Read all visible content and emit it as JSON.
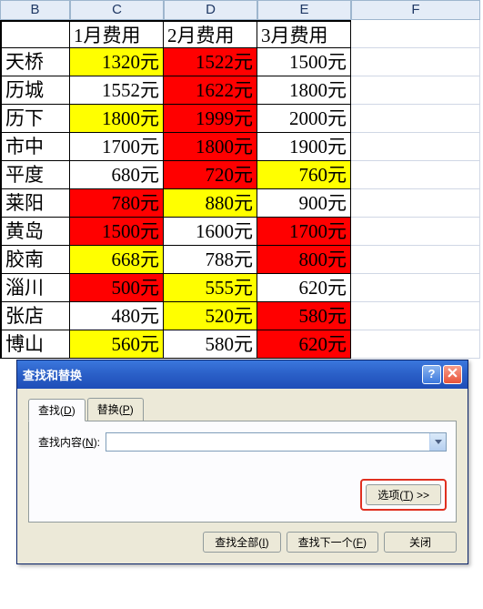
{
  "columns": [
    "B",
    "C",
    "D",
    "E",
    "F"
  ],
  "table": {
    "headers": [
      "",
      "1月费用",
      "2月费用",
      "3月费用"
    ],
    "rows": [
      {
        "name": "天桥",
        "cells": [
          {
            "v": "1320元",
            "c": "yellow"
          },
          {
            "v": "1522元",
            "c": "red"
          },
          {
            "v": "1500元",
            "c": "white"
          }
        ]
      },
      {
        "name": "历城",
        "cells": [
          {
            "v": "1552元",
            "c": "white"
          },
          {
            "v": "1622元",
            "c": "red"
          },
          {
            "v": "1800元",
            "c": "white"
          }
        ]
      },
      {
        "name": "历下",
        "cells": [
          {
            "v": "1800元",
            "c": "yellow"
          },
          {
            "v": "1999元",
            "c": "red"
          },
          {
            "v": "2000元",
            "c": "white"
          }
        ]
      },
      {
        "name": "市中",
        "cells": [
          {
            "v": "1700元",
            "c": "white"
          },
          {
            "v": "1800元",
            "c": "red"
          },
          {
            "v": "1900元",
            "c": "white"
          }
        ]
      },
      {
        "name": "平度",
        "cells": [
          {
            "v": "680元",
            "c": "white"
          },
          {
            "v": "720元",
            "c": "red"
          },
          {
            "v": "760元",
            "c": "yellow"
          }
        ]
      },
      {
        "name": "莱阳",
        "cells": [
          {
            "v": "780元",
            "c": "red"
          },
          {
            "v": "880元",
            "c": "yellow"
          },
          {
            "v": "900元",
            "c": "white"
          }
        ]
      },
      {
        "name": "黄岛",
        "cells": [
          {
            "v": "1500元",
            "c": "red"
          },
          {
            "v": "1600元",
            "c": "white"
          },
          {
            "v": "1700元",
            "c": "red"
          }
        ]
      },
      {
        "name": "胶南",
        "cells": [
          {
            "v": "668元",
            "c": "yellow"
          },
          {
            "v": "788元",
            "c": "white"
          },
          {
            "v": "800元",
            "c": "red"
          }
        ]
      },
      {
        "name": "淄川",
        "cells": [
          {
            "v": "500元",
            "c": "red"
          },
          {
            "v": "555元",
            "c": "yellow"
          },
          {
            "v": "620元",
            "c": "white"
          }
        ]
      },
      {
        "name": "张店",
        "cells": [
          {
            "v": "480元",
            "c": "white"
          },
          {
            "v": "520元",
            "c": "yellow"
          },
          {
            "v": "580元",
            "c": "red"
          }
        ]
      },
      {
        "name": "博山",
        "cells": [
          {
            "v": "560元",
            "c": "yellow"
          },
          {
            "v": "580元",
            "c": "white"
          },
          {
            "v": "620元",
            "c": "red"
          }
        ]
      }
    ]
  },
  "dialog": {
    "title": "查找和替换",
    "tab_find": "查找",
    "tab_find_key": "D",
    "tab_replace": "替换",
    "tab_replace_key": "P",
    "find_label": "查找内容",
    "find_label_key": "N",
    "find_value": "",
    "options_btn": "选项",
    "options_key": "T",
    "options_suffix": " >>",
    "find_all": "查找全部",
    "find_all_key": "I",
    "find_next": "查找下一个",
    "find_next_key": "F",
    "close": "关闭"
  }
}
